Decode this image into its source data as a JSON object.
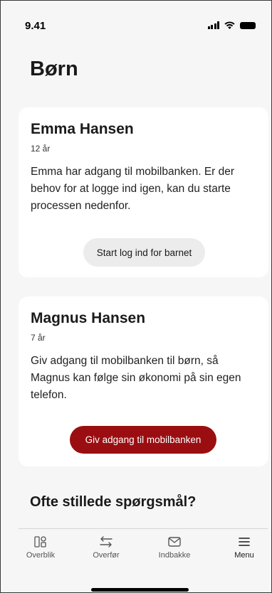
{
  "status_bar": {
    "time": "9.41"
  },
  "page": {
    "title": "Børn"
  },
  "children": [
    {
      "name": "Emma Hansen",
      "age": "12 år",
      "description": "Emma har adgang til mobilbanken. Er der behov for at logge ind igen, kan du starte processen nedenfor.",
      "button_label": "Start log ind for barnet"
    },
    {
      "name": "Magnus Hansen",
      "age": "7 år",
      "description": "Giv adgang til mobilbanken til børn, så Magnus kan følge sin økonomi på sin egen telefon.",
      "button_label": "Giv adgang til mobilbanken"
    }
  ],
  "faq": {
    "title": "Ofte stillede spørgsmål?"
  },
  "tabs": [
    {
      "label": "Overblik",
      "icon": "overview-icon",
      "active": false
    },
    {
      "label": "Overfør",
      "icon": "transfer-icon",
      "active": false
    },
    {
      "label": "Indbakke",
      "icon": "inbox-icon",
      "active": false
    },
    {
      "label": "Menu",
      "icon": "menu-icon",
      "active": true
    }
  ],
  "colors": {
    "primary": "#9a0e12",
    "background": "#f6f6f6",
    "card": "#ffffff",
    "secondary_button": "#ececec"
  }
}
